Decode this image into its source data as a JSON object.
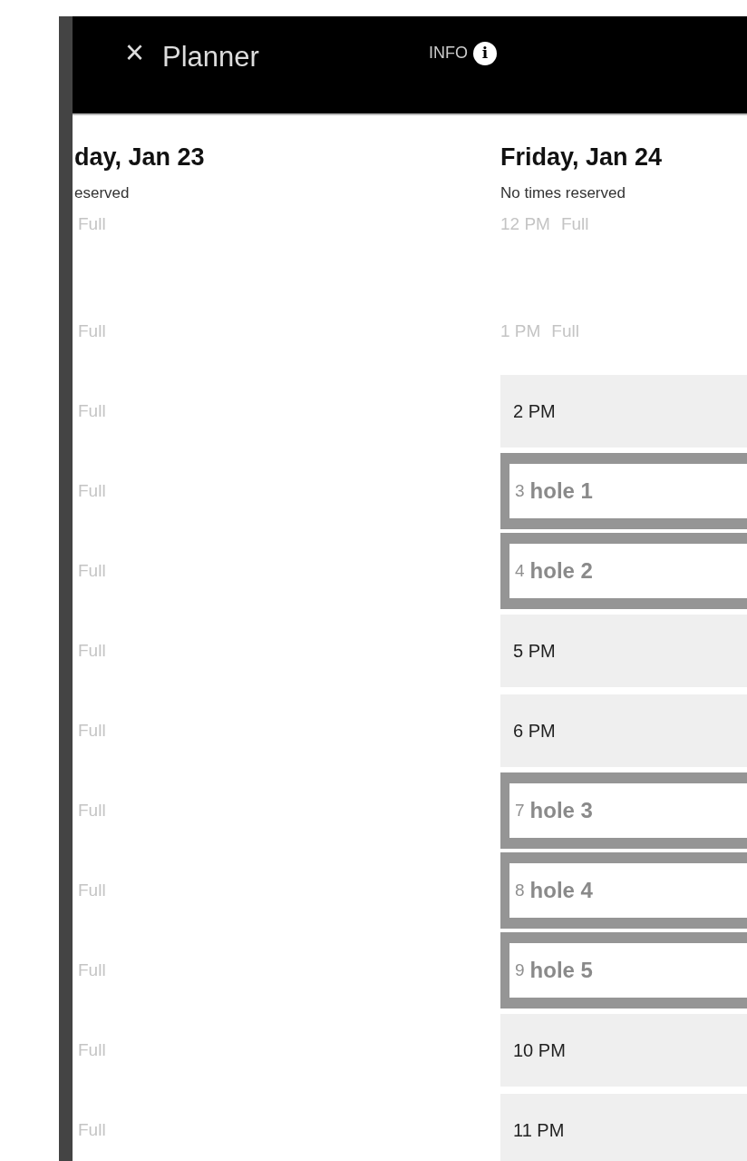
{
  "header": {
    "close": "×",
    "title": "Planner",
    "info_label": "INFO",
    "info_icon": "i"
  },
  "days": [
    {
      "title": "day, Jan 23",
      "subtitle": "eserved",
      "slots": [
        {
          "kind": "full",
          "status": "Full"
        },
        {
          "kind": "full",
          "status": "Full"
        },
        {
          "kind": "full",
          "status": "Full"
        },
        {
          "kind": "full",
          "status": "Full"
        },
        {
          "kind": "full",
          "status": "Full"
        },
        {
          "kind": "full",
          "status": "Full"
        },
        {
          "kind": "full",
          "status": "Full"
        },
        {
          "kind": "full",
          "status": "Full"
        },
        {
          "kind": "full",
          "status": "Full"
        },
        {
          "kind": "full",
          "status": "Full"
        },
        {
          "kind": "full",
          "status": "Full"
        },
        {
          "kind": "full",
          "status": "Full"
        }
      ]
    },
    {
      "title": "Friday, Jan 24",
      "subtitle": "No times reserved",
      "slots": [
        {
          "kind": "full",
          "time": "12 PM",
          "status": "Full"
        },
        {
          "kind": "full",
          "time": "1 PM",
          "status": "Full"
        },
        {
          "kind": "open",
          "time": "2 PM"
        },
        {
          "kind": "hole",
          "time": "3",
          "label": "hole 1"
        },
        {
          "kind": "hole",
          "time": "4",
          "label": "hole 2"
        },
        {
          "kind": "open",
          "time": "5 PM"
        },
        {
          "kind": "open",
          "time": "6 PM"
        },
        {
          "kind": "hole",
          "time": "7",
          "label": "hole 3"
        },
        {
          "kind": "hole",
          "time": "8",
          "label": "hole 4"
        },
        {
          "kind": "hole",
          "time": "9",
          "label": "hole 5"
        },
        {
          "kind": "open",
          "time": "10 PM"
        },
        {
          "kind": "open",
          "time": "11 PM"
        }
      ]
    }
  ]
}
